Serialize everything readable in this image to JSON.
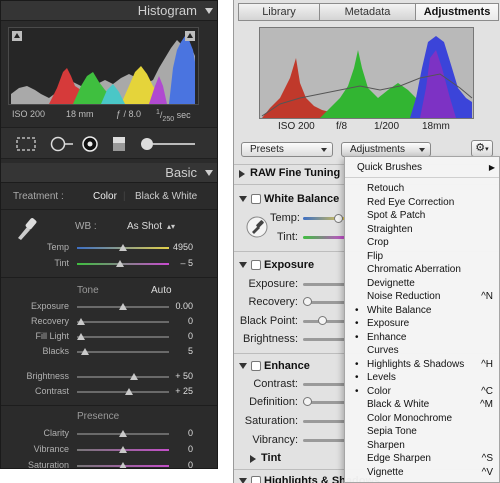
{
  "lightroom": {
    "histogram_title": "Histogram",
    "exif": {
      "iso": "ISO 200",
      "focal": "18 mm",
      "aperture": "ƒ / 8.0",
      "shutter_num": "1",
      "shutter_den": "250",
      "shutter_unit": "sec"
    },
    "basic_title": "Basic",
    "treatment_label": "Treatment :",
    "treatment_options": [
      "Color",
      "Black & White"
    ],
    "wb_label": "WB :",
    "wb_value": "As Shot",
    "sliders_wb": [
      {
        "label": "Temp",
        "value": "4950",
        "pos": 0.5
      },
      {
        "label": "Tint",
        "value": "– 5",
        "pos": 0.47
      }
    ],
    "tone_label": "Tone",
    "auto_label": "Auto",
    "sliders_tone": [
      {
        "label": "Exposure",
        "value": "0.00",
        "pos": 0.5
      },
      {
        "label": "Recovery",
        "value": "0",
        "pos": 0.0
      },
      {
        "label": "Fill Light",
        "value": "0",
        "pos": 0.0
      },
      {
        "label": "Blacks",
        "value": "5",
        "pos": 0.04
      }
    ],
    "sliders_bright": [
      {
        "label": "Brightness",
        "value": "+ 50",
        "pos": 0.62
      },
      {
        "label": "Contrast",
        "value": "+ 25",
        "pos": 0.57
      }
    ],
    "presence_label": "Presence",
    "sliders_presence": [
      {
        "label": "Clarity",
        "value": "0",
        "pos": 0.5
      },
      {
        "label": "Vibrance",
        "value": "0",
        "pos": 0.5
      },
      {
        "label": "Saturation",
        "value": "0",
        "pos": 0.5
      }
    ],
    "colors": {
      "panel": "#2b2b2b",
      "header": "#353535",
      "text": "#b5b5b5"
    }
  },
  "aperture": {
    "tabs": [
      "Library",
      "Metadata",
      "Adjustments"
    ],
    "active_tab": "Adjustments",
    "exif": {
      "iso": "ISO 200",
      "aperture": "f/8",
      "shutter": "1/200",
      "focal": "18mm"
    },
    "presets_label": "Presets",
    "adjustments_label": "Adjustments",
    "gear_symbol": "⚙",
    "sections": [
      {
        "title": "RAW Fine Tuning"
      },
      {
        "title": "White Balance",
        "rows": [
          "Temp:",
          "Tint:"
        ]
      },
      {
        "title": "Exposure",
        "rows": [
          "Exposure:",
          "Recovery:",
          "Black Point:",
          "Brightness:"
        ]
      },
      {
        "title": "Enhance",
        "rows": [
          "Contrast:",
          "Definition:",
          "Saturation:",
          "Vibrancy:"
        ]
      },
      {
        "title": "Tint"
      },
      {
        "title": "Highlights & Shadows"
      }
    ],
    "menu": {
      "top_item": "Quick Brushes",
      "items": [
        {
          "label": "Retouch",
          "checked": false,
          "shortcut": ""
        },
        {
          "label": "Red Eye Correction",
          "checked": false,
          "shortcut": ""
        },
        {
          "label": "Spot & Patch",
          "checked": false,
          "shortcut": ""
        },
        {
          "label": "Straighten",
          "checked": false,
          "shortcut": ""
        },
        {
          "label": "Crop",
          "checked": false,
          "shortcut": ""
        },
        {
          "label": "Flip",
          "checked": false,
          "shortcut": ""
        },
        {
          "label": "Chromatic Aberration",
          "checked": false,
          "shortcut": ""
        },
        {
          "label": "Devignette",
          "checked": false,
          "shortcut": ""
        },
        {
          "label": "Noise Reduction",
          "checked": false,
          "shortcut": "^N"
        },
        {
          "label": "White Balance",
          "checked": true,
          "shortcut": ""
        },
        {
          "label": "Exposure",
          "checked": true,
          "shortcut": ""
        },
        {
          "label": "Enhance",
          "checked": true,
          "shortcut": ""
        },
        {
          "label": "Curves",
          "checked": false,
          "shortcut": ""
        },
        {
          "label": "Highlights & Shadows",
          "checked": true,
          "shortcut": "^H"
        },
        {
          "label": "Levels",
          "checked": true,
          "shortcut": ""
        },
        {
          "label": "Color",
          "checked": true,
          "shortcut": "^C"
        },
        {
          "label": "Black & White",
          "checked": false,
          "shortcut": "^M"
        },
        {
          "label": "Color Monochrome",
          "checked": false,
          "shortcut": ""
        },
        {
          "label": "Sepia Tone",
          "checked": false,
          "shortcut": ""
        },
        {
          "label": "Sharpen",
          "checked": false,
          "shortcut": ""
        },
        {
          "label": "Edge Sharpen",
          "checked": false,
          "shortcut": "^S"
        },
        {
          "label": "Vignette",
          "checked": false,
          "shortcut": "^V"
        }
      ]
    },
    "colors": {
      "panel": "#e2e2e2",
      "histo_bg": "#b9b9b9"
    }
  }
}
